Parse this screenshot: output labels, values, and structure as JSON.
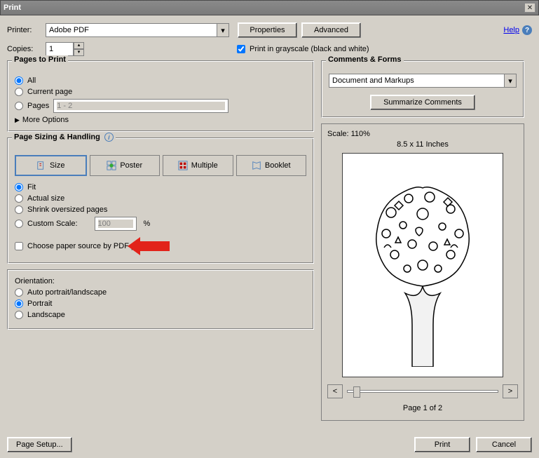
{
  "window": {
    "title": "Print"
  },
  "header": {
    "printer_label": "Printer:",
    "printer_value": "Adobe PDF",
    "properties_btn": "Properties",
    "advanced_btn": "Advanced",
    "help_link": "Help",
    "copies_label": "Copies:",
    "copies_value": "1",
    "grayscale_label": "Print in grayscale (black and white)"
  },
  "pages": {
    "legend": "Pages to Print",
    "all": "All",
    "current": "Current page",
    "pages_label": "Pages",
    "pages_value": "1 - 2",
    "more": "More Options"
  },
  "sizing": {
    "legend": "Page Sizing & Handling",
    "size_tab": "Size",
    "poster_tab": "Poster",
    "multiple_tab": "Multiple",
    "booklet_tab": "Booklet",
    "fit": "Fit",
    "actual": "Actual size",
    "shrink": "Shrink oversized pages",
    "custom_label": "Custom Scale:",
    "custom_value": "100",
    "custom_pct": "%",
    "paper_source": "Choose paper source by PDF page size"
  },
  "orientation": {
    "label": "Orientation:",
    "auto": "Auto portrait/landscape",
    "portrait": "Portrait",
    "landscape": "Landscape"
  },
  "comments": {
    "legend": "Comments & Forms",
    "select_value": "Document and Markups",
    "summarize_btn": "Summarize Comments"
  },
  "preview": {
    "scale": "Scale: 110%",
    "dimensions": "8.5 x 11 Inches",
    "pagenum": "Page 1 of 2"
  },
  "footer": {
    "page_setup_btn": "Page Setup...",
    "print_btn": "Print",
    "cancel_btn": "Cancel"
  }
}
